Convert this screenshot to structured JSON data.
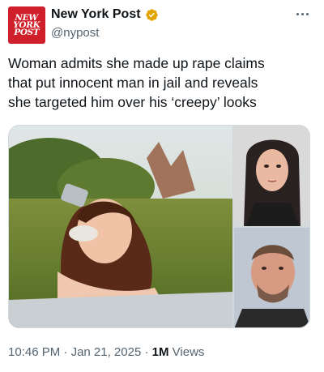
{
  "account": {
    "avatar_lines": [
      "NEW",
      "YORK",
      "POST"
    ],
    "display_name": "New York Post",
    "handle": "@nypost",
    "verified_color": "#e2a500"
  },
  "tweet": {
    "text": "Woman admits she made up rape claims\nthat put innocent man in jail and reveals\nshe targeted him over his ‘creepy’ looks",
    "time": "10:46 PM",
    "separator": "·",
    "date": "Jan 21, 2025",
    "views_count": "1M",
    "views_label": "Views"
  },
  "media": {
    "images": [
      {
        "name": "woman-lying-in-grass-photo"
      },
      {
        "name": "woman-mugshot-photo"
      },
      {
        "name": "man-mugshot-photo"
      }
    ]
  },
  "icons": {
    "verified": "verified-badge-icon",
    "more": "more-options-icon"
  },
  "colors": {
    "text_primary": "#0f1419",
    "text_secondary": "#536471",
    "brand_red": "#cf1f2a"
  }
}
